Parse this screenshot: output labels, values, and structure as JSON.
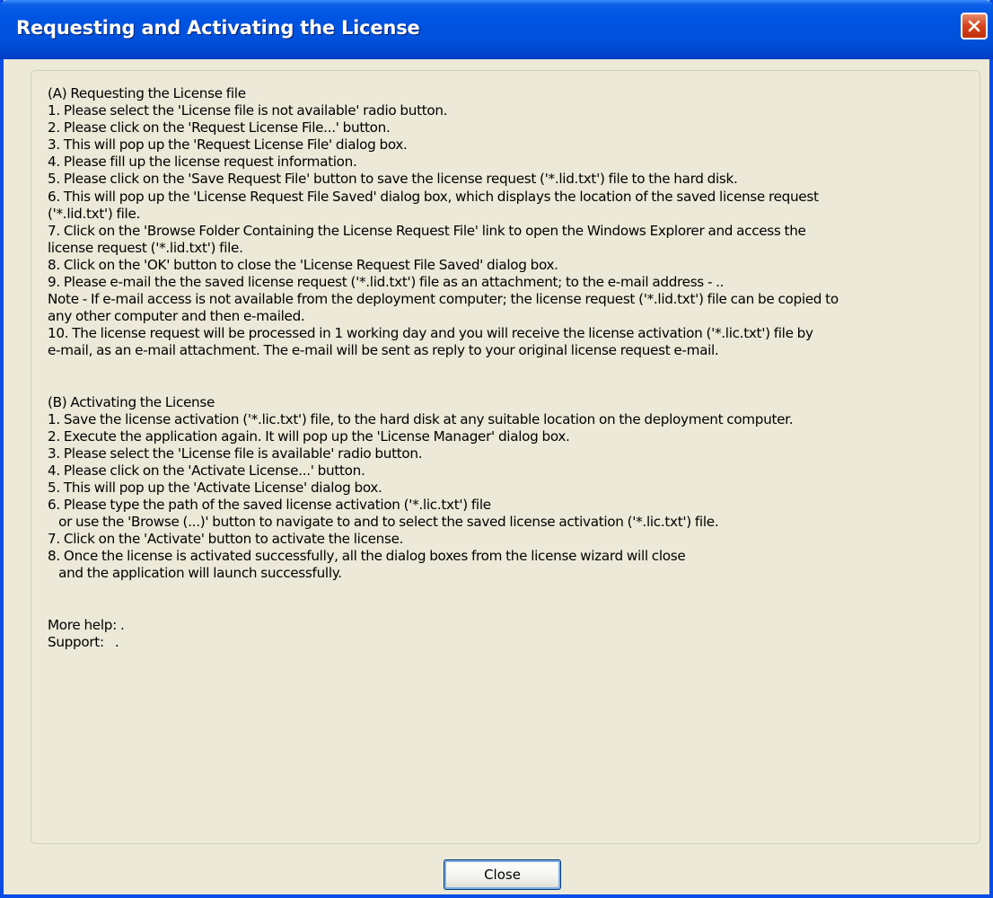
{
  "window": {
    "title": "Requesting and Activating the License"
  },
  "colors": {
    "titlebar": "#0054e3",
    "window_bg": "#ece9d8",
    "close_button": "#d6421b"
  },
  "section_a": {
    "heading": "(A) Requesting the License file",
    "lines": [
      "1. Please select the 'License file is not available' radio button.",
      "2. Please click on the 'Request License File...' button.",
      "3. This will pop up the 'Request License File' dialog box.",
      "4. Please fill up the license request information.",
      "5. Please click on the 'Save Request File' button to save the license request ('*.lid.txt') file to the hard disk.",
      "6. This will pop up the 'License Request File Saved' dialog box, which displays the location of the saved license request",
      "('*.lid.txt') file.",
      "7. Click on the 'Browse Folder Containing the License Request File' link to open the Windows Explorer and access the",
      "license request ('*.lid.txt') file.",
      "8. Click on the 'OK' button to close the 'License Request File Saved' dialog box.",
      "9. Please e-mail the the saved license request ('*.lid.txt') file as an attachment; to the e-mail address - ..",
      "Note - If e-mail access is not available from the deployment computer; the license request ('*.lid.txt') file can be copied to",
      "any other computer and then e-mailed.",
      "10. The license request will be processed in 1 working day and you will receive the license activation ('*.lic.txt') file by",
      "e-mail, as an e-mail attachment. The e-mail will be sent as reply to your original license request e-mail."
    ]
  },
  "section_b": {
    "heading": "(B) Activating the License",
    "lines": [
      "1. Save the license activation ('*.lic.txt') file, to the hard disk at any suitable location on the deployment computer.",
      "2. Execute the application again. It will pop up the 'License Manager' dialog box.",
      "3. Please select the 'License file is available' radio button.",
      "4. Please click on the 'Activate License...' button.",
      "5. This will pop up the 'Activate License' dialog box.",
      "6. Please type the path of the saved license activation ('*.lic.txt') file",
      "   or use the 'Browse (...)' button to navigate to and to select the saved license activation ('*.lic.txt') file.",
      "7. Click on the 'Activate' button to activate the license.",
      "8. Once the license is activated successfully, all the dialog boxes from the license wizard will close",
      "   and the application will launch successfully."
    ]
  },
  "footer": {
    "more_help": "More help: .",
    "support": "Support:   ."
  },
  "buttons": {
    "close_label": "Close"
  }
}
